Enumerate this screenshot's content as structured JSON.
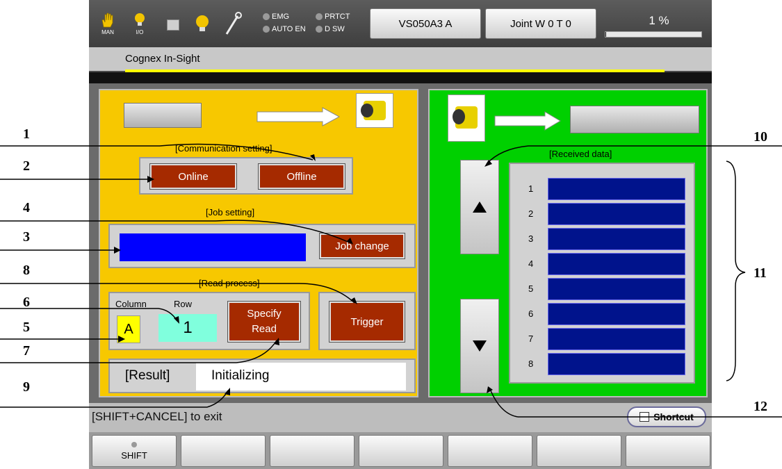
{
  "topbar": {
    "man_label": "MAN",
    "io_label": "I/O",
    "leds": [
      "EMG",
      "PRTCT",
      "AUTO EN",
      "D SW"
    ],
    "robot_model": "VS050A3 A",
    "joint_label": "Joint  W 0 T 0",
    "speed_percent": "1 %",
    "speed_value": 1
  },
  "window_title": "Cognex In-Sight",
  "left_panel": {
    "comm_heading": "[Communication setting]",
    "online_label": "Online",
    "offline_label": "Offline",
    "job_heading": "[Job setting]",
    "job_name_value": "",
    "job_change_label": "Job change",
    "read_heading": "[Read process]",
    "column_label": "Column",
    "row_label": "Row",
    "column_value": "A",
    "row_value": "1",
    "specify_read_line1": "Specify",
    "specify_read_line2": "Read",
    "trigger_label": "Trigger",
    "result_label": "[Result]",
    "result_value": "Initializing"
  },
  "right_panel": {
    "heading": "[Received data]",
    "rows": [
      "1",
      "2",
      "3",
      "4",
      "5",
      "6",
      "7",
      "8"
    ]
  },
  "status": {
    "exit_hint": "[SHIFT+CANCEL] to exit",
    "shortcut_label": "Shortcut"
  },
  "fkeys": {
    "shift_label": "SHIFT"
  },
  "callouts": [
    "1",
    "2",
    "3",
    "4",
    "5",
    "6",
    "7",
    "8",
    "9",
    "10",
    "11",
    "12"
  ],
  "colors": {
    "left_panel": "#f7c800",
    "right_panel": "#00d000",
    "action_button": "#a52a00",
    "job_field": "#0000ff",
    "received_row": "#00138c",
    "column_field": "#ffff00",
    "row_field": "#80ffdd"
  }
}
